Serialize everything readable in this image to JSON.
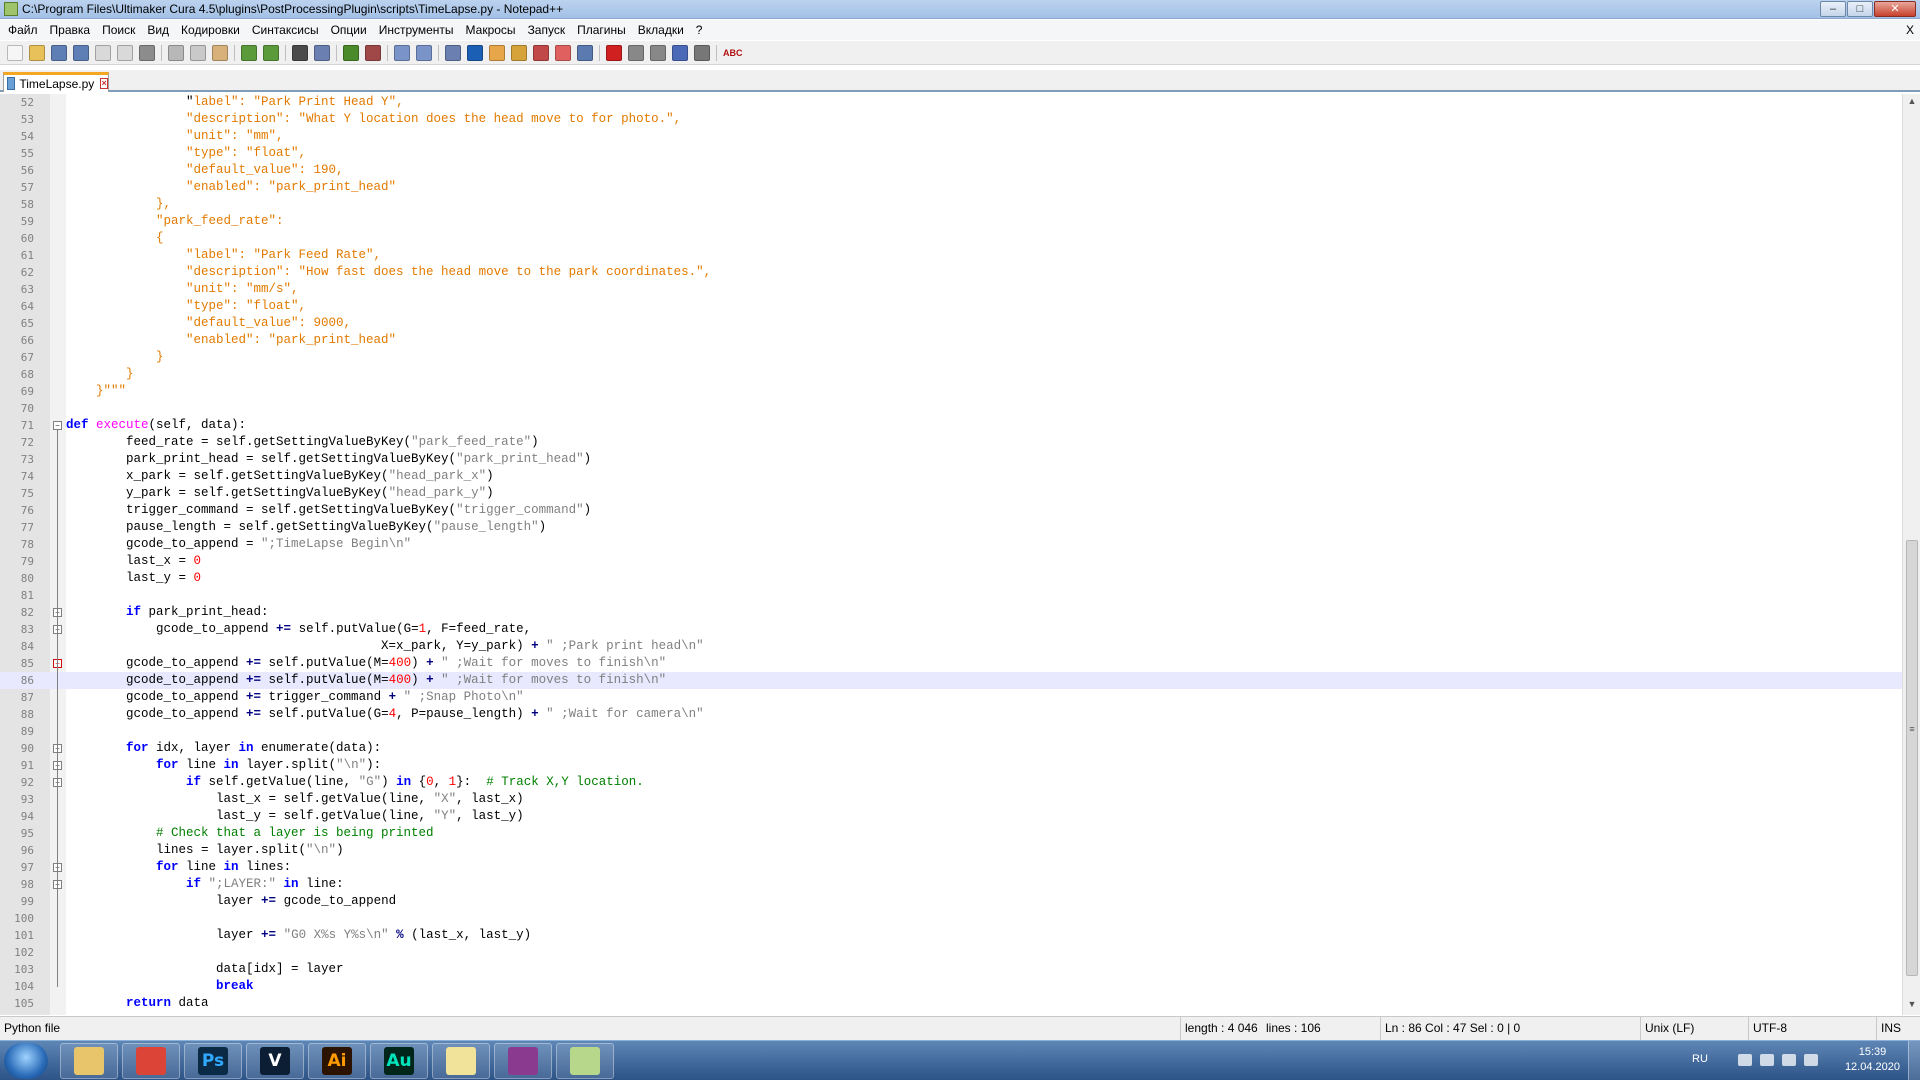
{
  "window": {
    "title": "C:\\Program Files\\Ultimaker Cura 4.5\\plugins\\PostProcessingPlugin\\scripts\\TimeLapse.py - Notepad++",
    "buttons": {
      "minimize": "–",
      "maximize": "□",
      "close": "✕"
    }
  },
  "menu": {
    "items": [
      "Файл",
      "Правка",
      "Поиск",
      "Вид",
      "Кодировки",
      "Синтаксисы",
      "Опции",
      "Инструменты",
      "Макросы",
      "Запуск",
      "Плагины",
      "Вкладки",
      "?"
    ],
    "close_doc": "X"
  },
  "toolbar": {
    "icons": [
      "new-file-icon",
      "open-file-icon",
      "save-icon",
      "save-all-icon",
      "close-icon",
      "close-all-icon",
      "print-icon",
      "cut-icon",
      "copy-icon",
      "paste-icon",
      "undo-icon",
      "redo-icon",
      "find-icon",
      "replace-icon",
      "zoom-in-icon",
      "zoom-out-icon",
      "sync-vertical-icon",
      "sync-horizontal-icon",
      "word-wrap-icon",
      "show-all-chars-icon",
      "indent-guide-icon",
      "doc-map-icon",
      "function-list-icon",
      "folder-workspace-icon",
      "monitoring-icon",
      "record-macro-icon",
      "stop-record-icon",
      "playback-icon",
      "run-macro-multiple-icon",
      "save-macro-icon",
      "spell-check-icon"
    ],
    "spellcheck_label": "ABC"
  },
  "tab": {
    "label": "TimeLapse.py"
  },
  "editor": {
    "current_line": 86,
    "lines": [
      {
        "n": "52",
        "fold": "",
        "parts": [
          [
            "",
            "                \""
          ],
          [
            "o",
            "label\": \"Park Print Head Y\","
          ]
        ]
      },
      {
        "n": "53",
        "fold": "",
        "parts": [
          [
            "o",
            "                \"description\": \"What Y location does the head move to for photo.\","
          ]
        ]
      },
      {
        "n": "54",
        "fold": "",
        "parts": [
          [
            "o",
            "                \"unit\": \"mm\","
          ]
        ]
      },
      {
        "n": "55",
        "fold": "",
        "parts": [
          [
            "o",
            "                \"type\": \"float\","
          ]
        ]
      },
      {
        "n": "56",
        "fold": "",
        "parts": [
          [
            "o",
            "                \"default_value\": 190,"
          ]
        ]
      },
      {
        "n": "57",
        "fold": "",
        "parts": [
          [
            "o",
            "                \"enabled\": \"park_print_head\""
          ]
        ]
      },
      {
        "n": "58",
        "fold": "",
        "parts": [
          [
            "o",
            "            },"
          ]
        ]
      },
      {
        "n": "59",
        "fold": "",
        "parts": [
          [
            "o",
            "            \"park_feed_rate\":"
          ]
        ]
      },
      {
        "n": "60",
        "fold": "",
        "parts": [
          [
            "o",
            "            {"
          ]
        ]
      },
      {
        "n": "61",
        "fold": "",
        "parts": [
          [
            "o",
            "                \"label\": \"Park Feed Rate\","
          ]
        ]
      },
      {
        "n": "62",
        "fold": "",
        "parts": [
          [
            "o",
            "                \"description\": \"How fast does the head move to the park coordinates.\","
          ]
        ]
      },
      {
        "n": "63",
        "fold": "",
        "parts": [
          [
            "o",
            "                \"unit\": \"mm/s\","
          ]
        ]
      },
      {
        "n": "64",
        "fold": "",
        "parts": [
          [
            "o",
            "                \"type\": \"float\","
          ]
        ]
      },
      {
        "n": "65",
        "fold": "",
        "parts": [
          [
            "o",
            "                \"default_value\": 9000,"
          ]
        ]
      },
      {
        "n": "66",
        "fold": "",
        "parts": [
          [
            "o",
            "                \"enabled\": \"park_print_head\""
          ]
        ]
      },
      {
        "n": "67",
        "fold": "",
        "parts": [
          [
            "o",
            "            }"
          ]
        ]
      },
      {
        "n": "68",
        "fold": "",
        "parts": [
          [
            "o",
            "        }"
          ]
        ]
      },
      {
        "n": "69",
        "fold": "",
        "parts": [
          [
            "o",
            "    }\"\"\""
          ]
        ]
      },
      {
        "n": "70",
        "fold": "",
        "parts": [
          [
            "",
            ""
          ]
        ]
      },
      {
        "n": "71",
        "fold": "box",
        "parts": [
          [
            "k",
            "def "
          ],
          [
            "f",
            "execute"
          ],
          [
            "",
            "(self, data):"
          ]
        ]
      },
      {
        "n": "72",
        "fold": "",
        "parts": [
          [
            "",
            "        feed_rate = self.getSettingValueByKey("
          ],
          [
            "s",
            "\"park_feed_rate\""
          ],
          [
            "",
            ")"
          ]
        ]
      },
      {
        "n": "73",
        "fold": "",
        "parts": [
          [
            "",
            "        park_print_head = self.getSettingValueByKey("
          ],
          [
            "s",
            "\"park_print_head\""
          ],
          [
            "",
            ")"
          ]
        ]
      },
      {
        "n": "74",
        "fold": "",
        "parts": [
          [
            "",
            "        x_park = self.getSettingValueByKey("
          ],
          [
            "s",
            "\"head_park_x\""
          ],
          [
            "",
            ")"
          ]
        ]
      },
      {
        "n": "75",
        "fold": "",
        "parts": [
          [
            "",
            "        y_park = self.getSettingValueByKey("
          ],
          [
            "s",
            "\"head_park_y\""
          ],
          [
            "",
            ")"
          ]
        ]
      },
      {
        "n": "76",
        "fold": "",
        "parts": [
          [
            "",
            "        trigger_command = self.getSettingValueByKey("
          ],
          [
            "s",
            "\"trigger_command\""
          ],
          [
            "",
            ")"
          ]
        ]
      },
      {
        "n": "77",
        "fold": "",
        "parts": [
          [
            "",
            "        pause_length = self.getSettingValueByKey("
          ],
          [
            "s",
            "\"pause_length\""
          ],
          [
            "",
            ")"
          ]
        ]
      },
      {
        "n": "78",
        "fold": "",
        "parts": [
          [
            "",
            "        gcode_to_append = "
          ],
          [
            "s",
            "\";TimeLapse Begin\\n\""
          ]
        ]
      },
      {
        "n": "79",
        "fold": "",
        "parts": [
          [
            "",
            "        last_x = "
          ],
          [
            "n",
            "0"
          ]
        ]
      },
      {
        "n": "80",
        "fold": "",
        "parts": [
          [
            "",
            "        last_y = "
          ],
          [
            "n",
            "0"
          ]
        ]
      },
      {
        "n": "81",
        "fold": "",
        "parts": [
          [
            "",
            ""
          ]
        ]
      },
      {
        "n": "82",
        "fold": "box",
        "parts": [
          [
            "k",
            "        if "
          ],
          [
            "",
            "park_print_head:"
          ]
        ]
      },
      {
        "n": "83",
        "fold": "box",
        "parts": [
          [
            "",
            "            gcode_to_append "
          ],
          [
            "op",
            "+="
          ],
          [
            "",
            " self.putValue(G="
          ],
          [
            "n",
            "1"
          ],
          [
            "",
            ", F=feed_rate,"
          ]
        ]
      },
      {
        "n": "84",
        "fold": "",
        "parts": [
          [
            "",
            "                                          X=x_park, Y=y_park) "
          ],
          [
            "op",
            "+"
          ],
          [
            "",
            " "
          ],
          [
            "s",
            "\" ;Park print head\\n\""
          ]
        ]
      },
      {
        "n": "85",
        "fold": "red",
        "parts": [
          [
            "",
            "        gcode_to_append "
          ],
          [
            "op",
            "+="
          ],
          [
            "",
            " self.putValue(M="
          ],
          [
            "n",
            "400"
          ],
          [
            "",
            ") "
          ],
          [
            "op",
            "+"
          ],
          [
            "",
            " "
          ],
          [
            "s",
            "\" ;Wait for moves to finish\\n\""
          ]
        ]
      },
      {
        "n": "86",
        "fold": "",
        "parts": [
          [
            "",
            "        gcode_to_append "
          ],
          [
            "op",
            "+="
          ],
          [
            "",
            " self.putValue(M="
          ],
          [
            "n",
            "400"
          ],
          [
            "",
            ") "
          ],
          [
            "op",
            "+"
          ],
          [
            "",
            " "
          ],
          [
            "s",
            "\" ;Wait for moves to finish\\n\""
          ]
        ]
      },
      {
        "n": "87",
        "fold": "",
        "parts": [
          [
            "",
            "        gcode_to_append "
          ],
          [
            "op",
            "+="
          ],
          [
            "",
            " trigger_command "
          ],
          [
            "op",
            "+"
          ],
          [
            "",
            " "
          ],
          [
            "s",
            "\" ;Snap Photo\\n\""
          ]
        ]
      },
      {
        "n": "88",
        "fold": "",
        "parts": [
          [
            "",
            "        gcode_to_append "
          ],
          [
            "op",
            "+="
          ],
          [
            "",
            " self.putValue(G="
          ],
          [
            "n",
            "4"
          ],
          [
            "",
            ", P=pause_length) "
          ],
          [
            "op",
            "+"
          ],
          [
            "",
            " "
          ],
          [
            "s",
            "\" ;Wait for camera\\n\""
          ]
        ]
      },
      {
        "n": "89",
        "fold": "",
        "parts": [
          [
            "",
            ""
          ]
        ]
      },
      {
        "n": "90",
        "fold": "box",
        "parts": [
          [
            "k",
            "        for "
          ],
          [
            "",
            "idx, layer "
          ],
          [
            "k",
            "in "
          ],
          [
            "",
            "enumerate(data):"
          ]
        ]
      },
      {
        "n": "91",
        "fold": "box",
        "parts": [
          [
            "k",
            "            for "
          ],
          [
            "",
            "line "
          ],
          [
            "k",
            "in "
          ],
          [
            "",
            "layer.split("
          ],
          [
            "s",
            "\"\\n\""
          ],
          [
            "",
            "):"
          ]
        ]
      },
      {
        "n": "92",
        "fold": "box",
        "parts": [
          [
            "k",
            "                if "
          ],
          [
            "",
            "self.getValue(line, "
          ],
          [
            "s",
            "\"G\""
          ],
          [
            "",
            ") "
          ],
          [
            "k",
            "in "
          ],
          [
            "",
            "{"
          ],
          [
            "n",
            "0"
          ],
          [
            "",
            ", "
          ],
          [
            "n",
            "1"
          ],
          [
            "",
            "}:  "
          ],
          [
            "c",
            "# Track X,Y location."
          ]
        ]
      },
      {
        "n": "93",
        "fold": "",
        "parts": [
          [
            "",
            "                    last_x = self.getValue(line, "
          ],
          [
            "s",
            "\"X\""
          ],
          [
            "",
            ", last_x)"
          ]
        ]
      },
      {
        "n": "94",
        "fold": "",
        "parts": [
          [
            "",
            "                    last_y = self.getValue(line, "
          ],
          [
            "s",
            "\"Y\""
          ],
          [
            "",
            ", last_y)"
          ]
        ]
      },
      {
        "n": "95",
        "fold": "",
        "parts": [
          [
            "c",
            "            # Check that a layer is being printed"
          ]
        ]
      },
      {
        "n": "96",
        "fold": "",
        "parts": [
          [
            "",
            "            lines = layer.split("
          ],
          [
            "s",
            "\"\\n\""
          ],
          [
            "",
            ")"
          ]
        ]
      },
      {
        "n": "97",
        "fold": "box",
        "parts": [
          [
            "k",
            "            for "
          ],
          [
            "",
            "line "
          ],
          [
            "k",
            "in "
          ],
          [
            "",
            "lines:"
          ]
        ]
      },
      {
        "n": "98",
        "fold": "box",
        "parts": [
          [
            "k",
            "                if "
          ],
          [
            "s",
            "\";LAYER:\""
          ],
          [
            "k",
            " in "
          ],
          [
            "",
            "line:"
          ]
        ]
      },
      {
        "n": "99",
        "fold": "",
        "parts": [
          [
            "",
            "                    layer "
          ],
          [
            "op",
            "+="
          ],
          [
            "",
            " gcode_to_append"
          ]
        ]
      },
      {
        "n": "100",
        "fold": "",
        "parts": [
          [
            "",
            ""
          ]
        ]
      },
      {
        "n": "101",
        "fold": "",
        "parts": [
          [
            "",
            "                    layer "
          ],
          [
            "op",
            "+="
          ],
          [
            "",
            " "
          ],
          [
            "s",
            "\"G0 X%s Y%s\\n\""
          ],
          [
            "",
            " "
          ],
          [
            "op",
            "%"
          ],
          [
            "",
            " (last_x, last_y)"
          ]
        ]
      },
      {
        "n": "102",
        "fold": "",
        "parts": [
          [
            "",
            ""
          ]
        ]
      },
      {
        "n": "103",
        "fold": "",
        "parts": [
          [
            "",
            "                    data[idx] = layer"
          ]
        ]
      },
      {
        "n": "104",
        "fold": "end",
        "parts": [
          [
            "k",
            "                    break"
          ]
        ]
      },
      {
        "n": "105",
        "fold": "",
        "parts": [
          [
            "k",
            "        return "
          ],
          [
            "",
            "data"
          ]
        ]
      }
    ]
  },
  "status": {
    "filetype": "Python file",
    "length": "length : 4 046",
    "lines": "lines : 106",
    "position": "Ln : 86    Col : 47    Sel : 0 | 0",
    "eol": "Unix (LF)",
    "encoding": "UTF-8",
    "mode": "INS"
  },
  "taskbar": {
    "apps": [
      {
        "name": "explorer",
        "glyph": "",
        "bg": "#e8c46a",
        "fg": "#7a5a1a"
      },
      {
        "name": "chrome",
        "glyph": "",
        "bg": "#db4437",
        "fg": "#ffffff"
      },
      {
        "name": "photoshop",
        "glyph": "Ps",
        "bg": "#0a2a45",
        "fg": "#31a8ff"
      },
      {
        "name": "vegas",
        "glyph": "V",
        "bg": "#0c1e33",
        "fg": "#ffffff"
      },
      {
        "name": "illustrator",
        "glyph": "Ai",
        "bg": "#2b1300",
        "fg": "#ff9a00"
      },
      {
        "name": "audition",
        "glyph": "Au",
        "bg": "#00261c",
        "fg": "#00e4bb"
      },
      {
        "name": "folder",
        "glyph": "",
        "bg": "#f2e39a",
        "fg": "#8a7a2a"
      },
      {
        "name": "winrar",
        "glyph": "",
        "bg": "#8a3b8f",
        "fg": "#ffffff"
      },
      {
        "name": "notepadpp",
        "glyph": "",
        "bg": "#b7d88a",
        "fg": "#3c6e1a"
      }
    ],
    "lang": "RU",
    "time": "15:39",
    "date": "12.04.2020"
  }
}
